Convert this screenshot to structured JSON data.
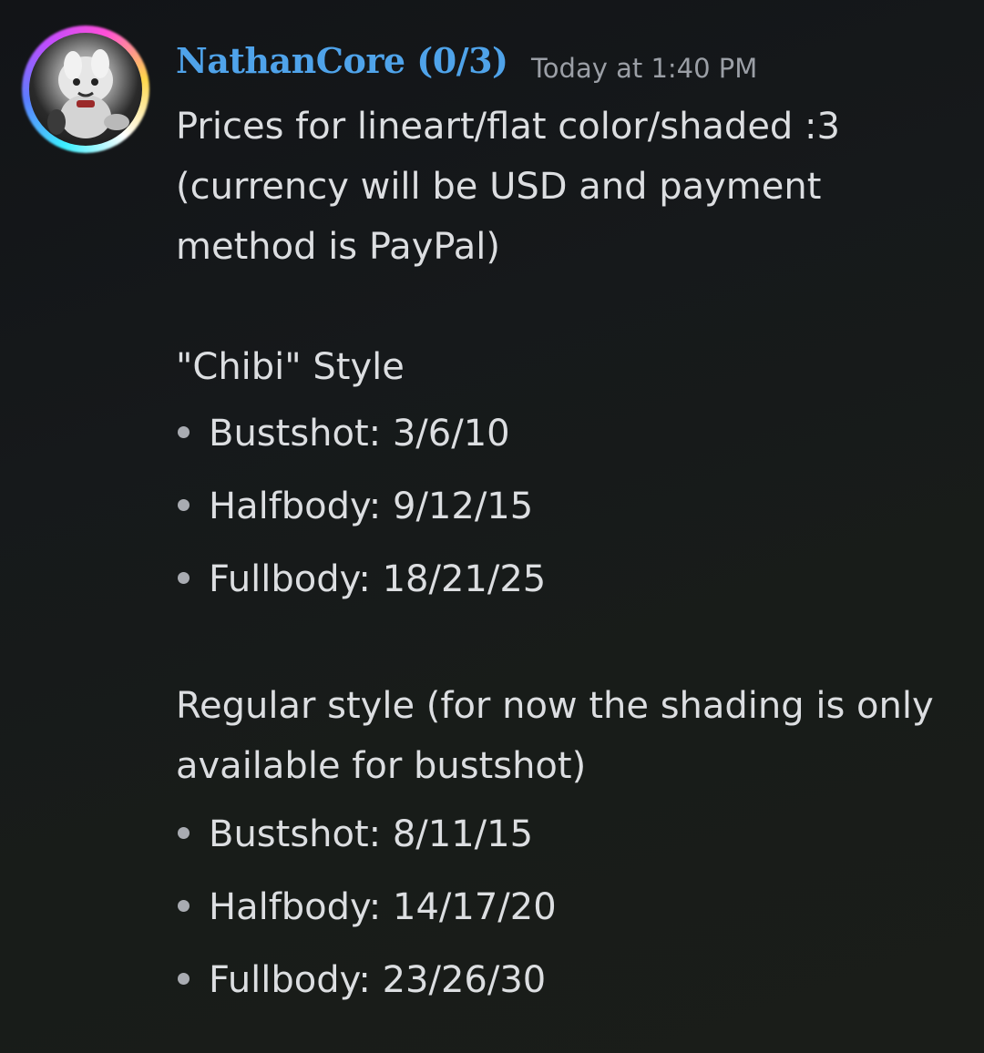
{
  "message": {
    "author": "NathanCore (0/3)",
    "timestamp": "Today at 1:40 PM",
    "intro_lines": [
      "Prices for lineart/flat color/shaded :3",
      "(currency will be USD and payment",
      "method is PayPal)"
    ],
    "sections": [
      {
        "heading_lines": [
          "\"Chibi\" Style"
        ],
        "items": [
          "Bustshot: 3/6/10",
          "Halfbody: 9/12/15",
          "Fullbody: 18/21/25"
        ]
      },
      {
        "heading_lines": [
          "Regular style (for now the shading is only",
          "available for bustshot)"
        ],
        "items": [
          "Bustshot: 8/11/15",
          "Halfbody: 14/17/20",
          "Fullbody: 23/26/30"
        ]
      }
    ]
  },
  "colors": {
    "username": "#4fa3ea",
    "timestamp": "#9b9fa6",
    "text": "#dcdee1"
  },
  "icons": {
    "avatar": "avatar-image"
  }
}
